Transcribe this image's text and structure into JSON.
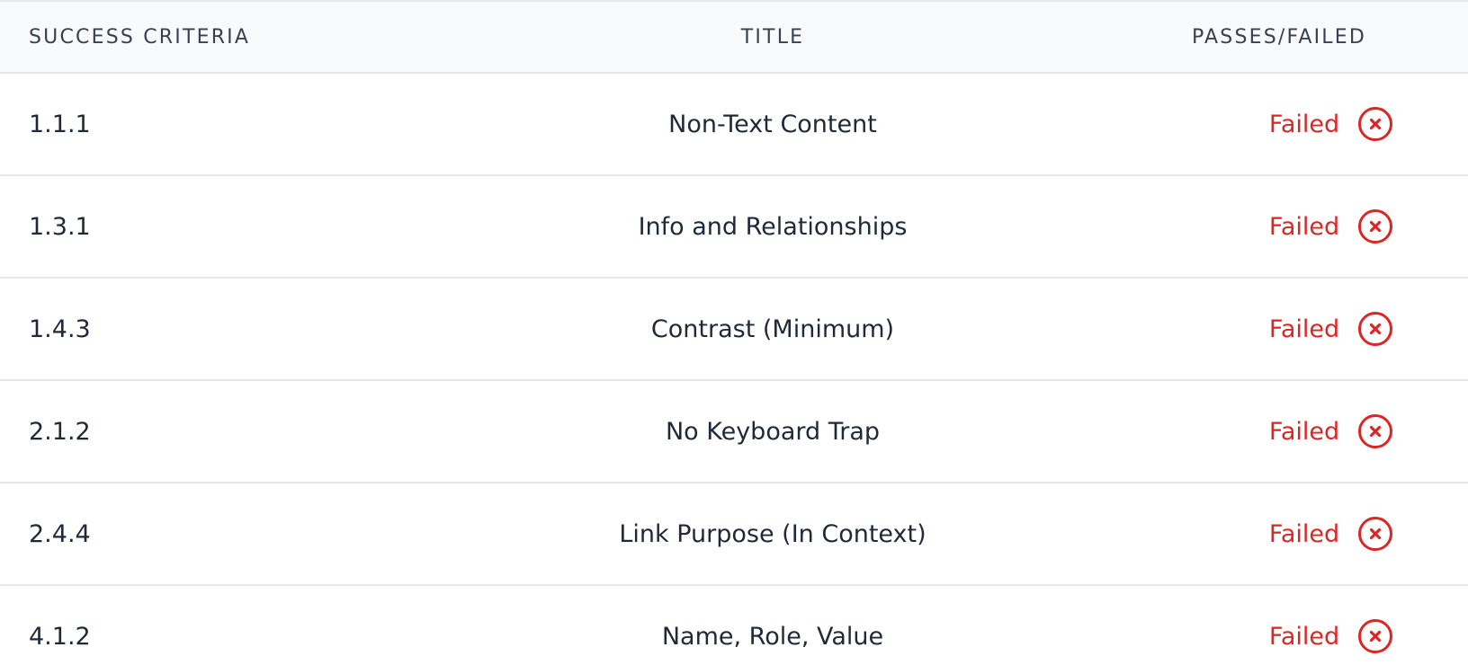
{
  "colors": {
    "failed": "#dc2626",
    "header_bg": "#f9fafb",
    "border": "#e5e7eb"
  },
  "table": {
    "headers": {
      "success_criteria": "SUCCESS CRITERIA",
      "title": "TITLE",
      "passes_failed": "PASSES/FAILED"
    },
    "rows": [
      {
        "criteria": "1.1.1",
        "title": "Non-Text Content",
        "status": "Failed",
        "status_icon": "x-circle-icon"
      },
      {
        "criteria": "1.3.1",
        "title": "Info and Relationships",
        "status": "Failed",
        "status_icon": "x-circle-icon"
      },
      {
        "criteria": "1.4.3",
        "title": "Contrast (Minimum)",
        "status": "Failed",
        "status_icon": "x-circle-icon"
      },
      {
        "criteria": "2.1.2",
        "title": "No Keyboard Trap",
        "status": "Failed",
        "status_icon": "x-circle-icon"
      },
      {
        "criteria": "2.4.4",
        "title": "Link Purpose (In Context)",
        "status": "Failed",
        "status_icon": "x-circle-icon"
      },
      {
        "criteria": "4.1.2",
        "title": "Name, Role, Value",
        "status": "Failed",
        "status_icon": "x-circle-icon"
      }
    ]
  }
}
